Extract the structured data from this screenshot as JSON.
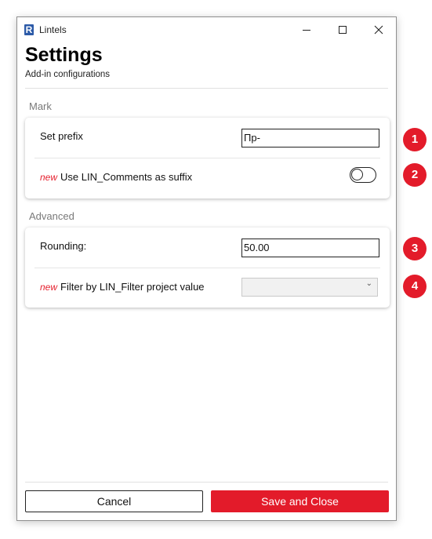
{
  "window": {
    "title": "Lintels",
    "logo_letter": "R"
  },
  "header": {
    "title": "Settings",
    "subtitle": "Add-in configurations"
  },
  "sections": {
    "mark": {
      "label": "Mark",
      "set_prefix": {
        "label": "Set prefix",
        "value": "Пр-"
      },
      "use_comments": {
        "new_tag": "new",
        "label": "Use LIN_Comments as suffix",
        "enabled": false
      }
    },
    "advanced": {
      "label": "Advanced",
      "rounding": {
        "label": "Rounding:",
        "value": "50.00"
      },
      "filter": {
        "new_tag": "new",
        "label": "Filter by LIN_Filter project value",
        "selected": ""
      }
    }
  },
  "footer": {
    "cancel_label": "Cancel",
    "save_label": "Save and Close"
  },
  "badges": [
    "1",
    "2",
    "3",
    "4"
  ],
  "colors": {
    "accent": "#e31b2a",
    "new_tag": "#e5202e"
  }
}
